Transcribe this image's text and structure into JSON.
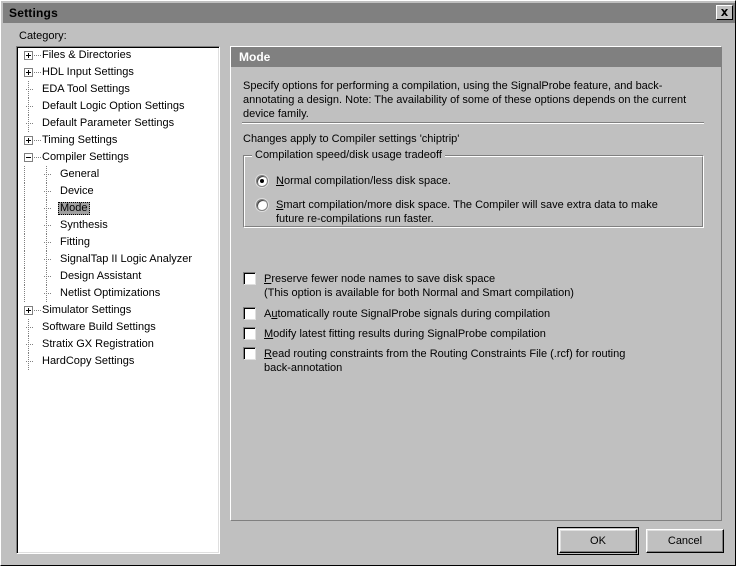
{
  "window": {
    "title": "Settings",
    "close_icon": "close-icon"
  },
  "sidebar": {
    "label": "Category:",
    "items": [
      {
        "label": "Files & Directories",
        "level": 1,
        "expander": "plus"
      },
      {
        "label": "HDL Input Settings",
        "level": 1,
        "expander": "plus"
      },
      {
        "label": "EDA Tool Settings",
        "level": 1,
        "expander": "none"
      },
      {
        "label": "Default Logic Option Settings",
        "level": 1,
        "expander": "none"
      },
      {
        "label": "Default Parameter Settings",
        "level": 1,
        "expander": "none"
      },
      {
        "label": "Timing Settings",
        "level": 1,
        "expander": "plus"
      },
      {
        "label": "Compiler Settings",
        "level": 1,
        "expander": "minus"
      },
      {
        "label": "General",
        "level": 2,
        "expander": "none"
      },
      {
        "label": "Device",
        "level": 2,
        "expander": "none"
      },
      {
        "label": "Mode",
        "level": 2,
        "expander": "none",
        "selected": true
      },
      {
        "label": "Synthesis",
        "level": 2,
        "expander": "none"
      },
      {
        "label": "Fitting",
        "level": 2,
        "expander": "none"
      },
      {
        "label": "SignalTap II Logic Analyzer",
        "level": 2,
        "expander": "none"
      },
      {
        "label": "Design Assistant",
        "level": 2,
        "expander": "none"
      },
      {
        "label": "Netlist Optimizations",
        "level": 2,
        "expander": "none"
      },
      {
        "label": "Simulator Settings",
        "level": 1,
        "expander": "plus"
      },
      {
        "label": "Software Build Settings",
        "level": 1,
        "expander": "none"
      },
      {
        "label": "Stratix GX Registration",
        "level": 1,
        "expander": "none"
      },
      {
        "label": "HardCopy Settings",
        "level": 1,
        "expander": "none"
      }
    ]
  },
  "panel": {
    "header": "Mode",
    "description": "Specify options for performing a compilation, using the SignalProbe feature, and back-annotating a design. Note: The availability of some of these options depends on the current device family.",
    "changes_apply": "Changes apply to Compiler settings 'chiptrip'",
    "groupbox": {
      "title": "Compilation speed/disk usage tradeoff",
      "radios": [
        {
          "accel": "N",
          "rest": "ormal compilation/less disk space.",
          "checked": true
        },
        {
          "accel": "S",
          "rest": "mart compilation/more disk space.  The Compiler will save extra data to make future re-compilations run faster.",
          "checked": false
        }
      ]
    },
    "checkboxes": [
      {
        "accel": "P",
        "rest": "reserve fewer node names to save disk space",
        "line2": "(This option is available for both Normal and Smart compilation)",
        "checked": false
      },
      {
        "pre": "A",
        "accel": "u",
        "rest": "tomatically route SignalProbe signals during compilation",
        "line2": "",
        "checked": false
      },
      {
        "accel": "M",
        "rest": "odify latest fitting results during SignalProbe compilation",
        "line2": "",
        "checked": false
      },
      {
        "accel": "R",
        "rest": "ead routing constraints from the Routing Constraints File (.rcf) for routing",
        "line2": "back-annotation",
        "checked": false
      }
    ]
  },
  "buttons": {
    "ok": "OK",
    "cancel": "Cancel"
  },
  "colors": {
    "face": "#c0c0c0",
    "titlebar": "#808080",
    "panel_header": "#808080",
    "selection": "#a0a0a0"
  }
}
